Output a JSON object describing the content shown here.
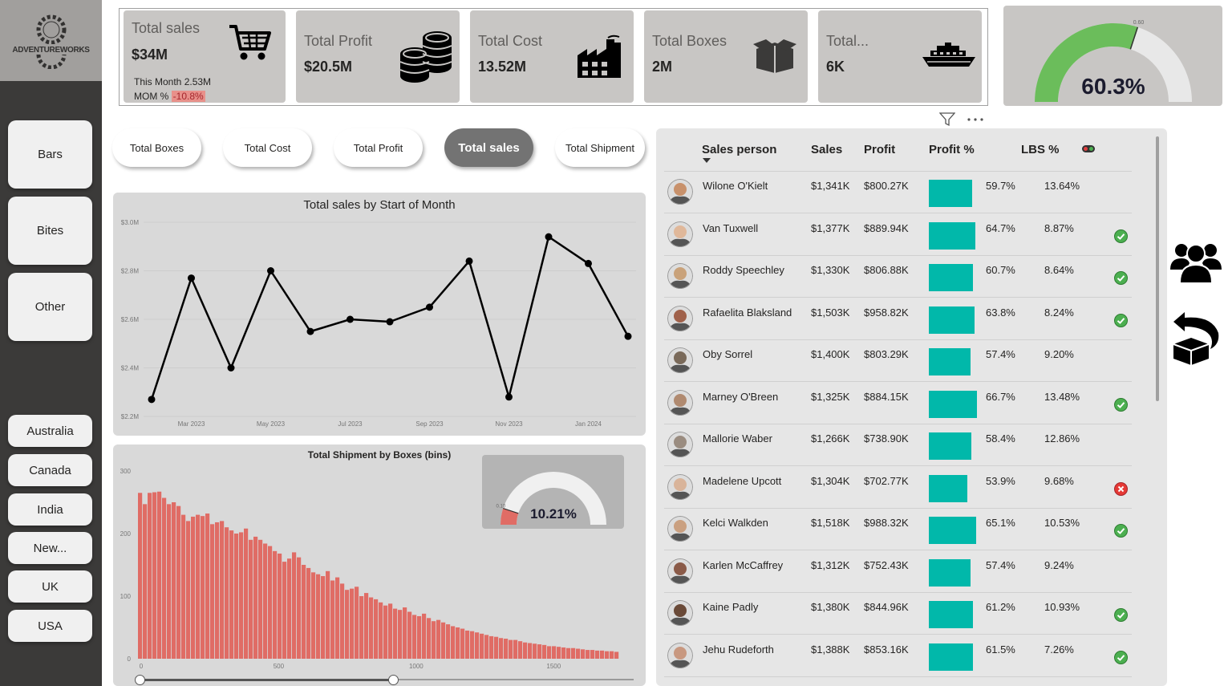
{
  "logo": {
    "text": "ADVENTUREWORKS"
  },
  "sidebar": {
    "categories": [
      {
        "label": "Bars"
      },
      {
        "label": "Bites"
      },
      {
        "label": "Other"
      }
    ],
    "countries": [
      {
        "label": "Australia"
      },
      {
        "label": "Canada"
      },
      {
        "label": "India"
      },
      {
        "label": "New..."
      },
      {
        "label": "UK"
      },
      {
        "label": "USA"
      }
    ]
  },
  "kpis": [
    {
      "label": "Total sales",
      "value": "$34M",
      "icon": "shopping-cart-icon",
      "this_month": "This Month 2.53M",
      "mom_label": "MOM % ",
      "mom_value": "-10.8%"
    },
    {
      "label": "Total Profit",
      "value": "$20.5M",
      "icon": "coins-icon"
    },
    {
      "label": "Total Cost",
      "value": "13.52M",
      "icon": "factory-icon"
    },
    {
      "label": "Total Boxes",
      "value": "2M",
      "icon": "box-icon"
    },
    {
      "label": "Total...",
      "value": "6K",
      "icon": "ship-icon"
    }
  ],
  "gauge_main": {
    "value_label": "60.3%",
    "target_label": "0.60",
    "fraction": 0.603,
    "fill_color": "#6bbd5b",
    "track_color": "#e8e8e8"
  },
  "toggles": [
    {
      "label": "Total Boxes",
      "active": false
    },
    {
      "label": "Total Cost",
      "active": false
    },
    {
      "label": "Total Profit",
      "active": false
    },
    {
      "label": "Total sales",
      "active": true
    },
    {
      "label": "Total Shipment",
      "active": false
    }
  ],
  "chart_data": [
    {
      "type": "line",
      "title": "Total sales by Start of Month",
      "x": [
        "Feb 2023",
        "Mar 2023",
        "Apr 2023",
        "May 2023",
        "Jun 2023",
        "Jul 2023",
        "Aug 2023",
        "Sep 2023",
        "Oct 2023",
        "Nov 2023",
        "Dec 2023",
        "Jan 2024",
        "Feb 2024"
      ],
      "x_tick_labels": [
        "Mar 2023",
        "May 2023",
        "Jul 2023",
        "Sep 2023",
        "Nov 2023",
        "Jan 2024"
      ],
      "y_tick_labels": [
        "$3.0M",
        "$2.8M",
        "$2.6M",
        "$2.4M",
        "$2.2M"
      ],
      "values": [
        2.27,
        2.77,
        2.4,
        2.8,
        2.55,
        2.6,
        2.59,
        2.65,
        2.84,
        2.28,
        2.94,
        2.83,
        2.53
      ],
      "ylim": [
        2.2,
        3.0
      ],
      "grid": true,
      "color": "#000000"
    },
    {
      "type": "bar",
      "title": "Total Shipment by Boxes (bins)",
      "x_tick_labels": [
        "0",
        "500",
        "1000",
        "1500"
      ],
      "y_tick_labels": [
        "300",
        "200",
        "100",
        "0"
      ],
      "xlim": [
        0,
        1750
      ],
      "ylim": [
        0,
        300
      ],
      "bin_width": 17.5,
      "values": [
        265,
        247,
        265,
        266,
        267,
        257,
        247,
        250,
        244,
        230,
        220,
        227,
        230,
        228,
        232,
        215,
        218,
        220,
        210,
        205,
        200,
        202,
        208,
        190,
        195,
        190,
        184,
        180,
        172,
        168,
        155,
        160,
        170,
        162,
        150,
        145,
        138,
        135,
        132,
        140,
        125,
        130,
        120,
        110,
        112,
        115,
        100,
        105,
        98,
        95,
        90,
        85,
        88,
        80,
        78,
        82,
        75,
        70,
        68,
        72,
        65,
        60,
        62,
        58,
        55,
        52,
        50,
        48,
        45,
        44,
        42,
        40,
        38,
        36,
        35,
        33,
        32,
        30,
        30,
        28,
        26,
        25,
        24,
        23,
        22,
        20,
        20,
        19,
        18,
        17,
        17,
        16,
        15,
        14,
        14,
        13,
        13,
        12,
        12,
        11
      ],
      "color": "#e06c65"
    }
  ],
  "gauge_small": {
    "value_label": "10.21%",
    "target_label": "0.10",
    "fraction": 0.1021,
    "fill_color": "#e06c65",
    "track_color": "#f0f0f0"
  },
  "table": {
    "headers": {
      "person": "Sales person",
      "sales": "Sales",
      "profit": "Profit",
      "profit_pct": "Profit %",
      "lbs": "LBS %"
    },
    "rows": [
      {
        "name": "Wilone O'Kielt",
        "sales": "$1,341K",
        "profit": "$800.27K",
        "profit_pct": "59.7%",
        "pct_value": 0.597,
        "lbs": "13.64%",
        "status": "none",
        "skin": "#c8916b"
      },
      {
        "name": "Van Tuxwell",
        "sales": "$1,377K",
        "profit": "$889.94K",
        "profit_pct": "64.7%",
        "pct_value": 0.647,
        "lbs": "8.87%",
        "status": "ok",
        "skin": "#e0b89a"
      },
      {
        "name": "Roddy Speechley",
        "sales": "$1,330K",
        "profit": "$806.88K",
        "profit_pct": "60.7%",
        "pct_value": 0.607,
        "lbs": "8.64%",
        "status": "ok",
        "skin": "#c9a27a"
      },
      {
        "name": "Rafaelita Blaksland",
        "sales": "$1,503K",
        "profit": "$958.82K",
        "profit_pct": "63.8%",
        "pct_value": 0.638,
        "lbs": "8.24%",
        "status": "ok",
        "skin": "#a0614a"
      },
      {
        "name": "Oby Sorrel",
        "sales": "$1,400K",
        "profit": "$803.29K",
        "profit_pct": "57.4%",
        "pct_value": 0.574,
        "lbs": "9.20%",
        "status": "none",
        "skin": "#7a6a5a"
      },
      {
        "name": "Marney O'Breen",
        "sales": "$1,325K",
        "profit": "$884.15K",
        "profit_pct": "66.7%",
        "pct_value": 0.667,
        "lbs": "13.48%",
        "status": "ok",
        "skin": "#b08a70"
      },
      {
        "name": "Mallorie Waber",
        "sales": "$1,266K",
        "profit": "$738.90K",
        "profit_pct": "58.4%",
        "pct_value": 0.584,
        "lbs": "12.86%",
        "status": "none",
        "skin": "#9a8c80"
      },
      {
        "name": "Madelene Upcott",
        "sales": "$1,304K",
        "profit": "$702.77K",
        "profit_pct": "53.9%",
        "pct_value": 0.539,
        "lbs": "9.68%",
        "status": "bad",
        "skin": "#d9b49a"
      },
      {
        "name": "Kelci Walkden",
        "sales": "$1,518K",
        "profit": "$988.32K",
        "profit_pct": "65.1%",
        "pct_value": 0.651,
        "lbs": "10.53%",
        "status": "ok",
        "skin": "#caa080"
      },
      {
        "name": "Karlen McCaffrey",
        "sales": "$1,312K",
        "profit": "$752.43K",
        "profit_pct": "57.4%",
        "pct_value": 0.574,
        "lbs": "9.24%",
        "status": "none",
        "skin": "#8a5a48"
      },
      {
        "name": "Kaine Padly",
        "sales": "$1,380K",
        "profit": "$844.96K",
        "profit_pct": "61.2%",
        "pct_value": 0.612,
        "lbs": "10.93%",
        "status": "ok",
        "skin": "#6a4a38"
      },
      {
        "name": "Jehu Rudeforth",
        "sales": "$1,388K",
        "profit": "$853.16K",
        "profit_pct": "61.5%",
        "pct_value": 0.615,
        "lbs": "7.26%",
        "status": "ok",
        "skin": "#c89880"
      }
    ]
  },
  "right_icons": [
    {
      "name": "team-icon"
    },
    {
      "name": "return-box-icon"
    }
  ]
}
